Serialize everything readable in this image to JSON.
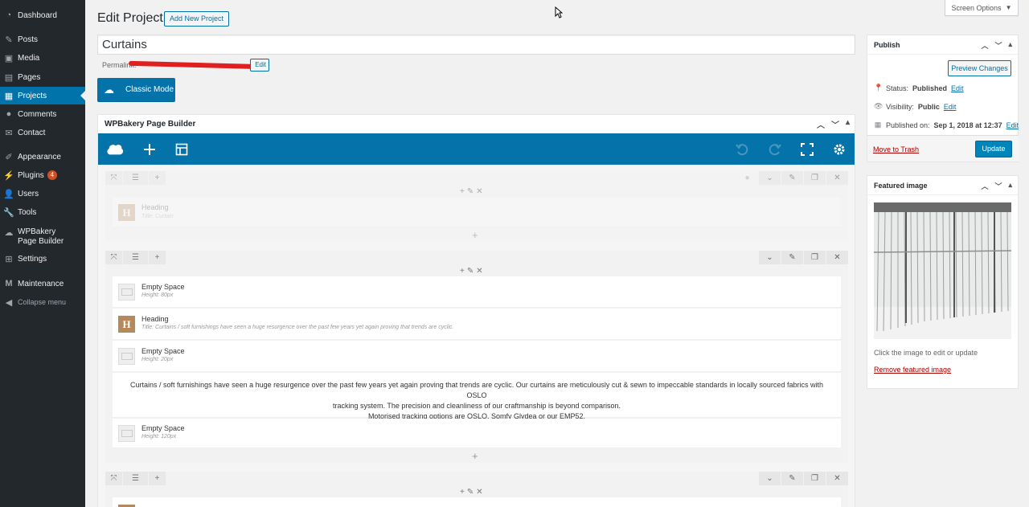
{
  "sidebar": {
    "items": [
      {
        "label": "Dashboard",
        "icon": "dashboard-icon"
      },
      {
        "label": "Posts",
        "icon": "pin-icon"
      },
      {
        "label": "Media",
        "icon": "media-icon"
      },
      {
        "label": "Pages",
        "icon": "pages-icon"
      },
      {
        "label": "Projects",
        "icon": "portfolio-icon"
      },
      {
        "label": "Comments",
        "icon": "comment-icon"
      },
      {
        "label": "Contact",
        "icon": "mail-icon"
      },
      {
        "label": "Appearance",
        "icon": "brush-icon"
      },
      {
        "label": "Plugins",
        "icon": "plugin-icon",
        "badge": "4"
      },
      {
        "label": "Users",
        "icon": "users-icon"
      },
      {
        "label": "Tools",
        "icon": "wrench-icon"
      },
      {
        "label": "WPBakery Page Builder",
        "icon": "wpbakery-icon"
      },
      {
        "label": "Settings",
        "icon": "settings-icon"
      },
      {
        "label": "Maintenance",
        "icon": "maintenance-icon"
      },
      {
        "label": "Collapse menu",
        "icon": "collapse-icon"
      }
    ]
  },
  "header": {
    "title": "Edit Project",
    "add_new": "Add New Project",
    "screen_options": "Screen Options"
  },
  "post": {
    "title": "Curtains",
    "permalink_label": "Permalink:",
    "permalink_edit": "Edit"
  },
  "classic_mode_label": "Classic Mode",
  "builder": {
    "title": "WPBakery Page Builder",
    "rows": [
      {
        "elements": [
          {
            "type": "heading",
            "name": "Heading",
            "sub": "Title: Curtain"
          }
        ]
      },
      {
        "elements": [
          {
            "type": "space",
            "name": "Empty Space",
            "sub": "Height: 80px"
          },
          {
            "type": "heading",
            "name": "Heading",
            "sub": "Title: Curtains / soft furnishings have seen a huge resurgence over the past few years yet again proving that trends are cyclic."
          },
          {
            "type": "space",
            "name": "Empty Space",
            "sub": "Height: 20px"
          },
          {
            "type": "text",
            "lines": [
              "Curtains / soft furnishings have seen a huge resurgence over the past few years yet again proving that trends are cyclic. Our curtains are meticulously cut & sewn to impeccable standards in locally sourced fabrics with OSLO",
              "tracking system. The precision and cleanliness of our craftmanship is beyond comparison.",
              "Motorised tracking options are OSLO, Somfy Glydea or our EMP52."
            ]
          },
          {
            "type": "space",
            "name": "Empty Space",
            "sub": "Height: 120px"
          }
        ]
      }
    ]
  },
  "publish": {
    "title": "Publish",
    "preview": "Preview Changes",
    "status_label": "Status:",
    "status_value": "Published",
    "visibility_label": "Visibility:",
    "visibility_value": "Public",
    "published_label": "Published on:",
    "published_value": "Sep 1, 2018 at 12:37",
    "edit": "Edit",
    "trash": "Move to Trash",
    "update": "Update"
  },
  "featured": {
    "title": "Featured image",
    "note": "Click the image to edit or update",
    "remove": "Remove featured image"
  }
}
